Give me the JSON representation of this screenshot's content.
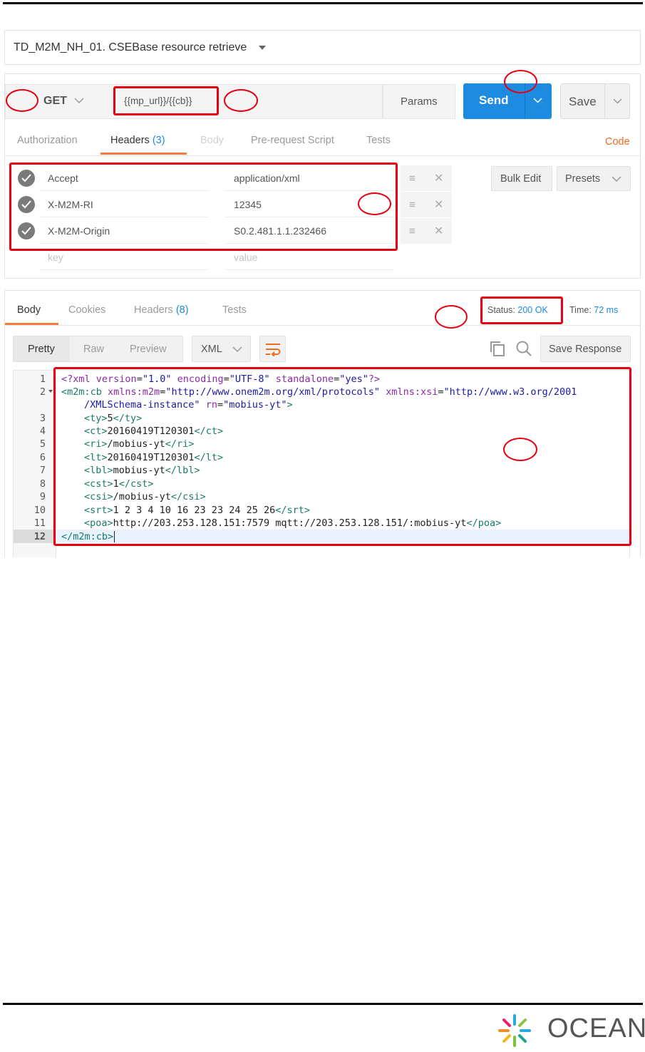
{
  "request": {
    "name": "TD_M2M_NH_01. CSEBase resource retrieve",
    "method": "GET",
    "url": "{{mp_url}}/{{cb}}",
    "params_label": "Params",
    "send_label": "Send",
    "save_label": "Save",
    "code_label": "Code",
    "tabs": [
      {
        "label": "Authorization"
      },
      {
        "label": "Headers",
        "count": "(3)"
      },
      {
        "label": "Body"
      },
      {
        "label": "Pre-request Script"
      },
      {
        "label": "Tests"
      }
    ],
    "headers": [
      {
        "key": "Accept",
        "value": "application/xml"
      },
      {
        "key": "X-M2M-RI",
        "value": "12345"
      },
      {
        "key": "X-M2M-Origin",
        "value": "S0.2.481.1.1.232466"
      }
    ],
    "key_placeholder": "key",
    "value_placeholder": "value",
    "bulk_edit_label": "Bulk Edit",
    "presets_label": "Presets"
  },
  "response": {
    "tabs": [
      {
        "label": "Body"
      },
      {
        "label": "Cookies"
      },
      {
        "label": "Headers",
        "count": "(8)"
      },
      {
        "label": "Tests"
      }
    ],
    "status_label": "Status:",
    "status_value": "200 OK",
    "time_label": "Time:",
    "time_value": "72 ms",
    "view_modes": [
      "Pretty",
      "Raw",
      "Preview"
    ],
    "format": "XML",
    "save_response_label": "Save Response",
    "line_numbers": [
      "1",
      "2",
      "3",
      "4",
      "5",
      "6",
      "7",
      "8",
      "9",
      "10",
      "11",
      "12"
    ],
    "code": {
      "l1": {
        "a": "<?xml ",
        "b": "version",
        "c": "=",
        "d": "\"1.0\"",
        "e": " encoding",
        "f": "=",
        "g": "\"UTF-8\"",
        "h": " standalone",
        "i": "=",
        "j": "\"yes\"",
        "k": "?>"
      },
      "l2": {
        "a": "<m2m:cb ",
        "b": "xmlns:m2m",
        "c": "=",
        "d": "\"http://www.onem2m.org/xml/protocols\"",
        "e": " xmlns:xsi",
        "f": "=",
        "g": "\"http://www.w3.org/2001"
      },
      "l2b": {
        "a": "/XMLSchema-instance\"",
        "b": " rn",
        "c": "=",
        "d": "\"mobius-yt\"",
        "e": ">"
      },
      "l3": {
        "open": "<ty>",
        "val": "5",
        "close": "</ty>"
      },
      "l4": {
        "open": "<ct>",
        "val": "20160419T120301",
        "close": "</ct>"
      },
      "l5": {
        "open": "<ri>",
        "val": "/mobius-yt",
        "close": "</ri>"
      },
      "l6": {
        "open": "<lt>",
        "val": "20160419T120301",
        "close": "</lt>"
      },
      "l7": {
        "open": "<lbl>",
        "val": "mobius-yt",
        "close": "</lbl>"
      },
      "l8": {
        "open": "<cst>",
        "val": "1",
        "close": "</cst>"
      },
      "l9": {
        "open": "<csi>",
        "val": "/mobius-yt",
        "close": "</csi>"
      },
      "l10": {
        "open": "<srt>",
        "val": "1 2 3 4 10 16 23 23 24 25 26",
        "close": "</srt>"
      },
      "l11": {
        "open": "<poa>",
        "val": "http://203.253.128.151:7579 mqtt://203.253.128.151/:mobius-yt",
        "close": "</poa>"
      },
      "l12": {
        "close": "</m2m:cb>"
      }
    }
  },
  "footer": {
    "brand": "OCEAN"
  },
  "colors": {
    "accent_blue": "#1d8ce0",
    "highlight_red": "#e60012",
    "tab_underline": "#f47c3c",
    "code_orange": "#f26b1d"
  }
}
